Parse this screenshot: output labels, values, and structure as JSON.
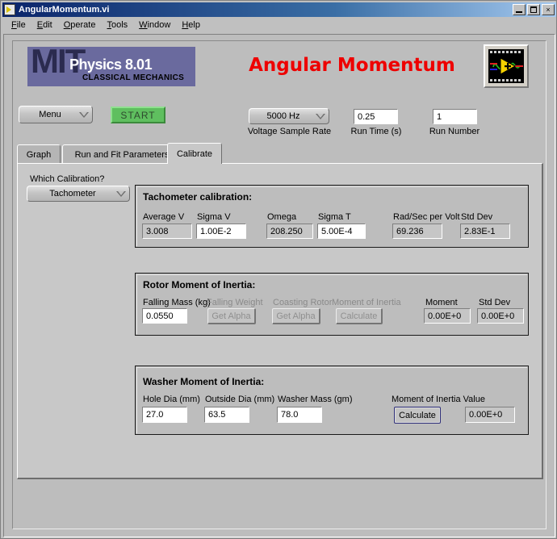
{
  "window": {
    "title": "AngularMomentum.vi",
    "icon": "labview-vi-icon",
    "buttons": {
      "minimize": "minimize-icon",
      "maximize": "maximize-icon",
      "close": "×"
    }
  },
  "menubar": {
    "items": [
      {
        "label": "File",
        "accel": "F"
      },
      {
        "label": "Edit",
        "accel": "E"
      },
      {
        "label": "Operate",
        "accel": "O"
      },
      {
        "label": "Tools",
        "accel": "T"
      },
      {
        "label": "Window",
        "accel": "W"
      },
      {
        "label": "Help",
        "accel": "H"
      }
    ]
  },
  "header": {
    "logo": {
      "institute": "MIT",
      "course": "Physics 8.01",
      "subtitle": "CLASSICAL MECHANICS",
      "background_color": "#6a6a9e"
    },
    "app_title": "Angular Momentum",
    "app_title_color": "#ee0000",
    "ni_logo": "labview-logo-icon"
  },
  "toolbar": {
    "menu_ring": {
      "label": "Menu",
      "arrow": "chevron-down-icon"
    },
    "start_button": "START",
    "sample_rate": {
      "value": "5000 Hz",
      "label": "Voltage Sample Rate"
    },
    "run_time": {
      "value": "0.25",
      "label": "Run Time (s)"
    },
    "run_number": {
      "value": "1",
      "label": "Run Number"
    }
  },
  "tabs": [
    {
      "label": "Graph",
      "active": false
    },
    {
      "label": "Run and Fit Parameters",
      "active": false
    },
    {
      "label": "Calibrate",
      "active": true
    }
  ],
  "calibration_selector": {
    "label": "Which Calibration?",
    "value": "Tachometer",
    "arrow": "chevron-down-icon"
  },
  "tachometer_panel": {
    "title": "Tachometer calibration:",
    "fields": [
      {
        "label": "Average V",
        "value": "3.008",
        "kind": "indicator"
      },
      {
        "label": "Sigma V",
        "value": "1.00E-2",
        "kind": "control"
      },
      {
        "label": "Omega",
        "value": "208.250",
        "kind": "indicator"
      },
      {
        "label": "Sigma T",
        "value": "5.00E-4",
        "kind": "control"
      },
      {
        "label": "Rad/Sec per Volt",
        "value": "69.236",
        "kind": "indicator"
      },
      {
        "label": "Std Dev",
        "value": "2.83E-1",
        "kind": "indicator"
      }
    ]
  },
  "rotor_panel": {
    "title": "Rotor Moment of Inertia:",
    "falling_mass": {
      "label": "Falling Mass (kg)",
      "value": "0.0550"
    },
    "falling_weight": {
      "label": "Falling Weight",
      "button": "Get Alpha",
      "disabled": true
    },
    "coasting_rotor": {
      "label": "Coasting Rotor",
      "button": "Get Alpha",
      "disabled": true
    },
    "moment_of_inertia": {
      "label": "Moment of Inertia",
      "button": "Calculate",
      "disabled": true
    },
    "moment": {
      "label": "Moment",
      "value": "0.00E+0"
    },
    "std_dev": {
      "label": "Std Dev",
      "value": "0.00E+0"
    }
  },
  "washer_panel": {
    "title": "Washer Moment of Inertia:",
    "hole_dia": {
      "label": "Hole Dia (mm)",
      "value": "27.0"
    },
    "outside_dia": {
      "label": "Outside Dia (mm)",
      "value": "63.5"
    },
    "washer_mass": {
      "label": "Washer Mass (gm)",
      "value": "78.0"
    },
    "moment_value": {
      "label": "Moment of Inertia Value",
      "button": "Calculate",
      "value": "0.00E+0"
    }
  }
}
